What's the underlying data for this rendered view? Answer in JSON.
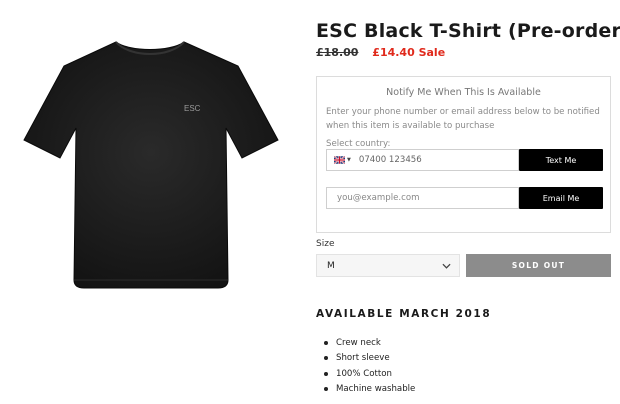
{
  "product": {
    "title": "ESC Black T-Shirt (Pre-order)",
    "image_logo_text": "ESC",
    "price_original": "£18.00",
    "price_sale": "£14.40 Sale"
  },
  "notify": {
    "title": "Notify Me When This Is Available",
    "description": "Enter your phone number or email address below to be notified when this item is available to purchase",
    "country_label": "Select country:",
    "country_flag": "uk-flag-icon",
    "phone_placeholder": "07400 123456",
    "text_button": "Text Me",
    "email_placeholder": "you@example.com",
    "email_button": "Email Me"
  },
  "size": {
    "label": "Size",
    "selected": "M"
  },
  "purchase": {
    "button_label": "SOLD OUT"
  },
  "availability": {
    "heading": "AVAILABLE MARCH 2018",
    "features": [
      "Crew neck",
      "Short sleeve",
      "100% Cotton",
      "Machine washable"
    ]
  },
  "colors": {
    "sale": "#e02a1c",
    "sold_out": "#8c8c8c",
    "button": "#000000",
    "shirt": "#1b1b1b"
  }
}
